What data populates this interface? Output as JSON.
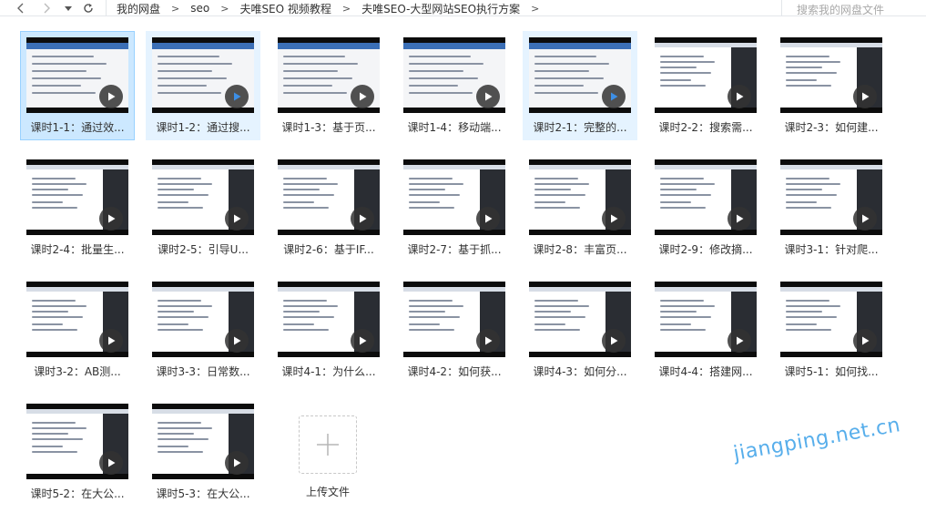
{
  "breadcrumb": [
    "我的网盘",
    "seo",
    "夫唯SEO 视频教程",
    "夫唯SEO-大型网站SEO执行方案"
  ],
  "breadcrumb_separator": ">",
  "search": {
    "placeholder": "搜索我的网盘文件"
  },
  "files": [
    {
      "name": "课时1-1：通过效...",
      "style": "slide",
      "play": "dark"
    },
    {
      "name": "课时1-2：通过搜...",
      "style": "slide",
      "play": "blue"
    },
    {
      "name": "课时1-3：基于页...",
      "style": "slide",
      "play": "dark"
    },
    {
      "name": "课时1-4：移动端...",
      "style": "slide",
      "play": "dark"
    },
    {
      "name": "课时2-1：完整的...",
      "style": "slide",
      "play": "blue"
    },
    {
      "name": "课时2-2：搜索需...",
      "style": "ide",
      "play": "dark"
    },
    {
      "name": "课时2-3：如何建...",
      "style": "ide",
      "play": "dark"
    },
    {
      "name": "课时2-4：批量生...",
      "style": "ide",
      "play": "dark"
    },
    {
      "name": "课时2-5：引导U...",
      "style": "ide",
      "play": "dark"
    },
    {
      "name": "课时2-6：基于IF...",
      "style": "ide",
      "play": "dark"
    },
    {
      "name": "课时2-7：基于抓...",
      "style": "ide",
      "play": "dark"
    },
    {
      "name": "课时2-8：丰富页...",
      "style": "ide",
      "play": "dark"
    },
    {
      "name": "课时2-9：修改摘...",
      "style": "ide",
      "play": "dark"
    },
    {
      "name": "课时3-1：针对爬...",
      "style": "ide",
      "play": "dark"
    },
    {
      "name": "课时3-2：AB测...",
      "style": "ide",
      "play": "dark"
    },
    {
      "name": "课时3-3：日常数...",
      "style": "ide",
      "play": "dark"
    },
    {
      "name": "课时4-1：为什么...",
      "style": "ide",
      "play": "dark"
    },
    {
      "name": "课时4-2：如何获...",
      "style": "ide",
      "play": "dark"
    },
    {
      "name": "课时4-3：如何分...",
      "style": "ide",
      "play": "dark"
    },
    {
      "name": "课时4-4：搭建网...",
      "style": "ide",
      "play": "dark"
    },
    {
      "name": "课时5-1：如何找...",
      "style": "ide",
      "play": "dark"
    },
    {
      "name": "课时5-2：在大公...",
      "style": "ide",
      "play": "dark"
    },
    {
      "name": "课时5-3：在大公...",
      "style": "ide",
      "play": "dark"
    }
  ],
  "upload_label": "上传文件",
  "watermark": "jiangping.net.cn",
  "colors": {
    "selection_bg": "#cce8ff",
    "hover_bg": "#e5f3ff",
    "accent": "#3d8fe6",
    "watermark": "#3aa0e8"
  }
}
